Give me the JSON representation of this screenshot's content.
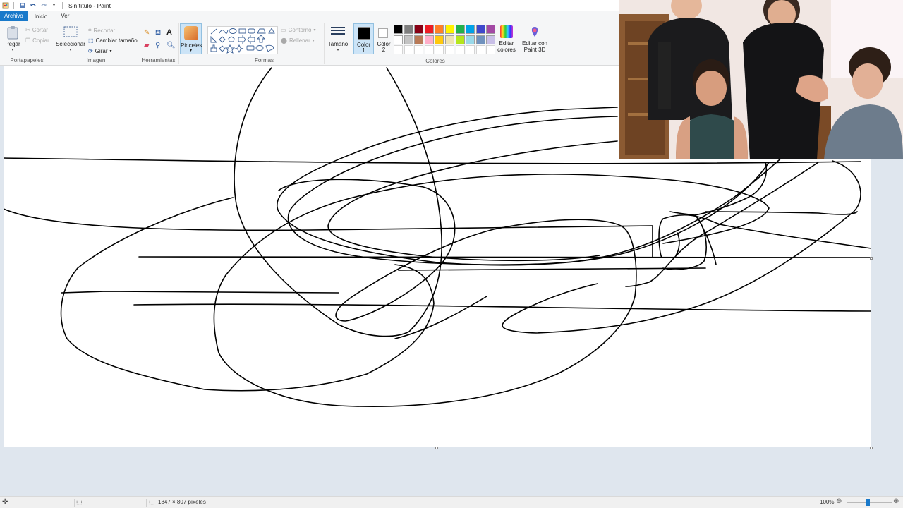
{
  "window": {
    "title": "Sin título - Paint"
  },
  "tabs": {
    "file": "Archivo",
    "home": "Inicio",
    "view": "Ver"
  },
  "ribbon": {
    "clipboard": {
      "label": "Portapapeles",
      "paste": "Pegar",
      "cut": "Cortar",
      "copy": "Copiar"
    },
    "image": {
      "label": "Imagen",
      "select": "Seleccionar",
      "crop": "Recortar",
      "resize": "Cambiar tamaño",
      "rotate": "Girar"
    },
    "tools": {
      "label": "Herramientas",
      "brushes": "Pinceles"
    },
    "shapes": {
      "label": "Formas",
      "outline": "Contorno",
      "fill": "Rellenar"
    },
    "size": {
      "label": "Tamaño"
    },
    "colors": {
      "label": "Colores",
      "color1": "Color",
      "color1_num": "1",
      "color2": "Color",
      "color2_num": "2",
      "edit_colors": "Editar colores",
      "paint3d": "Editar con Paint 3D",
      "color1_value": "#000000",
      "color2_value": "#ffffff",
      "palette_row1": [
        "#000000",
        "#7f7f7f",
        "#880015",
        "#ed1c24",
        "#ff7f27",
        "#fff200",
        "#22b14c",
        "#00a2e8",
        "#3f48cc",
        "#a349a4"
      ],
      "palette_row2": [
        "#ffffff",
        "#c3c3c3",
        "#b97a57",
        "#ffaec9",
        "#ffc90e",
        "#efe4b0",
        "#b5e61d",
        "#99d9ea",
        "#7092be",
        "#c8bfe7"
      ]
    }
  },
  "status": {
    "dimensions": "1847 × 807 píxeles",
    "zoom": "100%"
  }
}
